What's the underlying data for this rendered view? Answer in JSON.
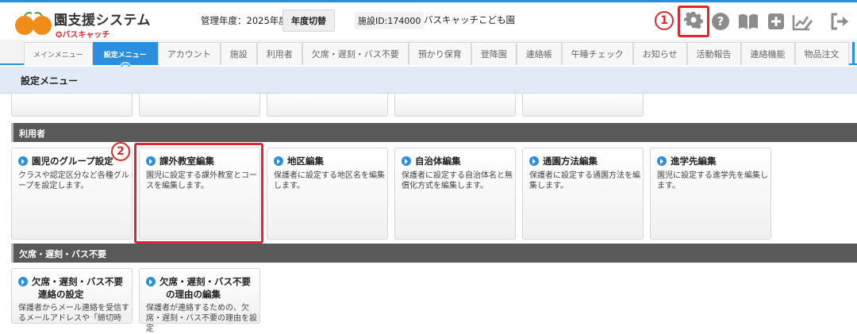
{
  "header": {
    "brand": "園支援システム",
    "brand_sub": "バスキャッチ",
    "fiscal_year_label": "管理年度：2025年度",
    "year_switch_label": "年度切替",
    "facility_id": "施設ID:174000",
    "facility_name": "バスキャッチこども園",
    "markers": {
      "one": "1",
      "two": "2"
    },
    "icons": [
      "gear-icon",
      "help-icon",
      "manual-book-icon",
      "plus-icon",
      "edit-chart-icon",
      "logout-icon"
    ]
  },
  "nav": {
    "tabs": [
      "メインメニュー",
      "設定メニュー",
      "アカウント",
      "施設",
      "利用者",
      "欠席・遅刻・バス不要",
      "預かり保育",
      "登降園",
      "連絡帳",
      "午睡チェック",
      "お知らせ",
      "活動報告",
      "連絡機能",
      "物品注文"
    ],
    "active_index": 1
  },
  "page": {
    "title": "設定メニュー"
  },
  "sections": [
    {
      "title": "利用者",
      "cards": [
        {
          "title": "園児のグループ設定",
          "desc": "クラスや認定区分など各種グループを設定します。"
        },
        {
          "title": "課外教室編集",
          "desc": "園児に設定する課外教室とコースを編集します。"
        },
        {
          "title": "地区編集",
          "desc": "保護者に設定する地区名を編集します。"
        },
        {
          "title": "自治体編集",
          "desc": "保護者に設定する自治体名と無償化方式を編集します。"
        },
        {
          "title": "通園方法編集",
          "desc": "保護者に設定する通園方法を編集します。"
        },
        {
          "title": "進学先編集",
          "desc": "園児に設定する進学先を編集します。"
        }
      ]
    },
    {
      "title": "欠席・遅刻・バス不要",
      "cards": [
        {
          "title_line1": "欠席・遅刻・バス不要",
          "title_line2": "連絡の設定",
          "desc": "保護者からメール連絡を受信するメールアドレスや「締切時"
        },
        {
          "title_line1": "欠席・遅刻・バス不要",
          "title_line2": "の理由の編集",
          "desc": "保護者が連絡するための、欠席・遅刻・バス不要の理由を設定"
        }
      ]
    }
  ],
  "colors": {
    "accent": "#2b8fe0",
    "annotation_red": "#e0272e",
    "section_bar": "#595959",
    "subheader": "#e1eaf5"
  }
}
